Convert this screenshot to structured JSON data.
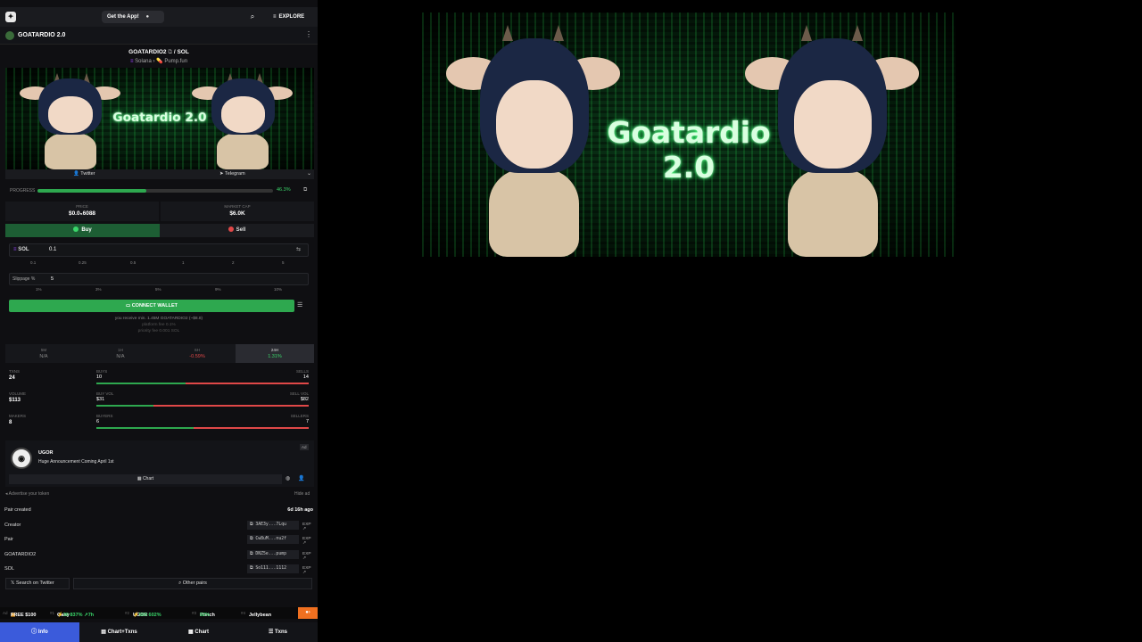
{
  "header": {
    "get_app": "Get the App!",
    "explore": "EXPLORE"
  },
  "token": {
    "name": "GOATARDIO 2.0",
    "pair": "GOATARDIO2",
    "pair_sep": "/",
    "quote": "SOL",
    "chain": "Solana",
    "dex": "Pump.fun",
    "banner_title": "Goatardio 2.0"
  },
  "socials": {
    "twitter": "Twitter",
    "telegram": "Telegram"
  },
  "progress": {
    "label": "PROGRESS",
    "value": "46.3%",
    "fraction": 0.463
  },
  "stats": {
    "price_label": "PRICE",
    "price_value": "$0.0₅6088",
    "mcap_label": "MARKET CAP",
    "mcap_value": "$6.0K"
  },
  "trade": {
    "buy": "Buy",
    "sell": "Sell",
    "currency": "SOL",
    "amount": "0.1",
    "presets": [
      "0.1",
      "0.25",
      "0.5",
      "1",
      "2",
      "5"
    ],
    "slippage_label": "Slippage %",
    "slippage_value": "5",
    "slippage_presets": [
      "1%",
      "3%",
      "5%",
      "9%",
      "10%"
    ],
    "connect": "CONNECT WALLET",
    "receive": "you receive min. 1.45M GOATARDIO2 (~$8.8)",
    "platform_fee": "platform fee 0.1%",
    "priority_fee": "priority fee 0.001 SOL"
  },
  "timeframes": [
    {
      "label": "5M",
      "value": "N/A",
      "tone": "na"
    },
    {
      "label": "1H",
      "value": "N/A",
      "tone": "na"
    },
    {
      "label": "6H",
      "value": "-0.59%",
      "tone": "neg"
    },
    {
      "label": "24H",
      "value": "1.31%",
      "tone": "pos"
    }
  ],
  "metrics": {
    "txns_label": "TXNS",
    "txns": "24",
    "volume_label": "VOLUME",
    "volume": "$113",
    "makers_label": "MAKERS",
    "makers": "8",
    "rows": [
      {
        "left_label": "BUYS",
        "right_label": "SELLS",
        "left": "10",
        "right": "14",
        "ratio": 0.42
      },
      {
        "left_label": "BUY VOL",
        "right_label": "SELL VOL",
        "left": "$31",
        "right": "$82",
        "ratio": 0.27
      },
      {
        "left_label": "BUYERS",
        "right_label": "SELLERS",
        "left": "6",
        "right": "7",
        "ratio": 0.46
      }
    ]
  },
  "ad": {
    "tag": "Ad",
    "name": "UGOR",
    "text": "Huge Announcement Coming April 1st",
    "chart": "Chart",
    "advertise": "Advertise your token",
    "hide": "Hide ad"
  },
  "info": {
    "pair_created_label": "Pair created",
    "pair_created_value": "6d 16h ago",
    "rows": [
      {
        "label": "Creator",
        "addr": "3AE3y...7Lqu",
        "exp": "EXP"
      },
      {
        "label": "Pair",
        "addr": "Cw8uM...nu2f",
        "exp": "EXP"
      },
      {
        "label": "GOATARDIO2",
        "addr": "DNZ5e...pump",
        "exp": "EXP"
      },
      {
        "label": "SOL",
        "addr": "So111...1112",
        "exp": "EXP"
      }
    ],
    "search_twitter": "Search on Twitter",
    "other_pairs": "Other pairs"
  },
  "ticker": {
    "items": [
      {
        "rank": "Ad",
        "name": "FREE $100"
      },
      {
        "rank": "#1",
        "name": "Gany",
        "pct": "⚡30 837% ↗7h"
      },
      {
        "rank": "#2",
        "name": "UGOR",
        "pct": "⚡500 602%"
      },
      {
        "rank": "#3",
        "name": "Punch",
        "pct": "92%"
      },
      {
        "rank": "#4",
        "name": "Jellybean"
      }
    ]
  },
  "nav": {
    "info": "Info",
    "chart_txns": "Chart+Txns",
    "chart": "Chart",
    "txns": "Txns"
  }
}
